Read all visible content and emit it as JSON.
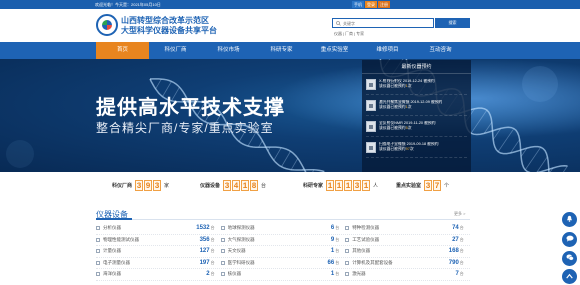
{
  "topbar": {
    "welcome": "欢迎光临！今天是：2021年05月10日",
    "login_label": "登录",
    "register_label": "注册",
    "extra_label": "手机"
  },
  "header": {
    "title_line1": "山西转型综合改革示范区",
    "title_line2": "大型科学仪器设备共享平台",
    "search_placeholder": "关键字",
    "search_button": "搜索",
    "search_links": [
      "仪器",
      "厂商",
      "专家"
    ]
  },
  "nav": {
    "items": [
      "首页",
      "科仪厂商",
      "科仪市场",
      "科研专家",
      "重点实验室",
      "维修项目",
      "互动咨询"
    ],
    "active_index": 0
  },
  "banner": {
    "headline": "提供高水平技术支撑",
    "subline": "整合精尖厂商/专家/重点实验室"
  },
  "latest": {
    "title": "最新仪器预约",
    "items": [
      {
        "name": "X-射线衍射仪",
        "date": "2019-12-24",
        "status": "被预约",
        "count_text": "该仪器已被预约",
        "count": "1",
        "unit": "次"
      },
      {
        "name": "激光共聚焦显微镜",
        "date": "2019-12-09",
        "status": "被预约",
        "count_text": "该仪器已被预约",
        "count": "1",
        "unit": "次"
      },
      {
        "name": "全反射仪NMR",
        "date": "2019-11-20",
        "status": "被预约",
        "count_text": "该仪器已被预约",
        "count": "5",
        "unit": "次"
      },
      {
        "name": "扫描电子显微镜",
        "date": "2019-09-18",
        "status": "被预约",
        "count_text": "该仪器已被预约",
        "count": "97",
        "unit": "次"
      }
    ]
  },
  "stats": [
    {
      "label": "科仪厂商",
      "digits": [
        "3",
        "9",
        "3"
      ],
      "unit": "家"
    },
    {
      "label": "仪器设备",
      "digits": [
        "3",
        "4",
        "1",
        "8"
      ],
      "unit": "台"
    },
    {
      "label": "科研专家",
      "digits": [
        "1",
        "1",
        "1",
        "3",
        "1"
      ],
      "unit": "人"
    },
    {
      "label": "重点实验室",
      "digits": [
        "3",
        "7"
      ],
      "unit": "个"
    }
  ],
  "equipment": {
    "title": "仪器设备",
    "more": "更多 >",
    "unit": "台",
    "rows": [
      [
        {
          "name": "分析仪器",
          "count": "1532"
        },
        {
          "name": "地球探测仪器",
          "count": "6"
        },
        {
          "name": "特种检测仪器",
          "count": "74"
        }
      ],
      [
        {
          "name": "物理性能测试仪器",
          "count": "356"
        },
        {
          "name": "大气探测仪器",
          "count": "9"
        },
        {
          "name": "工艺试验仪器",
          "count": "27"
        }
      ],
      [
        {
          "name": "计量仪器",
          "count": "127"
        },
        {
          "name": "天文仪器",
          "count": "1"
        },
        {
          "name": "其他仪器",
          "count": "168"
        }
      ],
      [
        {
          "name": "电子测量仪器",
          "count": "197"
        },
        {
          "name": "医学科研仪器",
          "count": "66"
        },
        {
          "name": "计算机及其配套设备",
          "count": "790"
        }
      ],
      [
        {
          "name": "海洋仪器",
          "count": "2"
        },
        {
          "name": "核仪器",
          "count": "1"
        },
        {
          "name": "激光器",
          "count": "7"
        }
      ]
    ]
  },
  "colors": {
    "brand_blue": "#1e63b4",
    "accent_orange": "#e8851f"
  }
}
